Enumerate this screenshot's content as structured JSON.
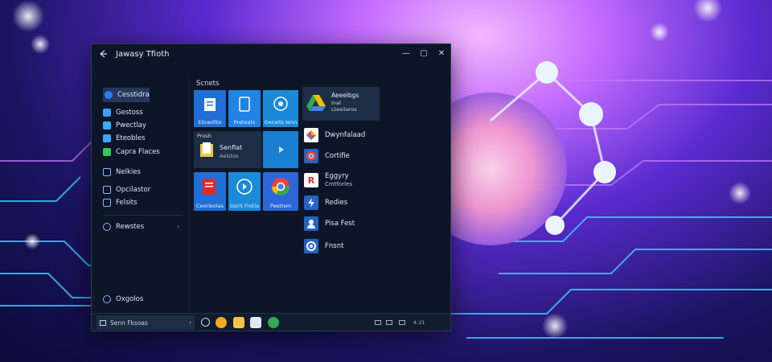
{
  "window": {
    "title": "Jawasy Tfioth",
    "controls": {
      "minimize": "—",
      "maximize": "▢",
      "close": "✕"
    }
  },
  "sidebar": {
    "items": [
      {
        "label": "Cesstidra",
        "icon": "compass-icon",
        "color": "#2f7bff"
      },
      {
        "label": "Gestoss",
        "icon": "shield-icon",
        "color": "#39a0ff"
      },
      {
        "label": "Pwectlay",
        "icon": "photo-icon",
        "color": "#36b0ff"
      },
      {
        "label": "Eteobles",
        "icon": "folder-icon",
        "color": "#3aa7ff"
      },
      {
        "label": "Capra Flaces",
        "icon": "sparkle-icon",
        "color": "#34c759"
      },
      {
        "label": "Nelkies",
        "icon": "chat-icon",
        "color": "#8fb3ff"
      },
      {
        "label": "Opcilastor",
        "icon": "document-icon",
        "color": "#8fb3ff"
      },
      {
        "label": "Felsits",
        "icon": "gear-icon",
        "color": "#8fb3ff"
      },
      {
        "label": "Rewstes",
        "icon": "user-icon",
        "color": "#8fb3ff"
      }
    ],
    "bottom": {
      "label": "Oxgolos",
      "icon": "refresh-icon"
    }
  },
  "main": {
    "section_label": "Scnets",
    "tiles": [
      {
        "label": "Etoaofite",
        "icon": "doc-icon",
        "color": "#1f6fd6"
      },
      {
        "label": "Pretoats",
        "icon": "tablet-icon",
        "color": "#1f84e6"
      },
      {
        "label": "Geceits Ienn",
        "icon": "globe-icon",
        "color": "#1a8ad9"
      },
      {
        "label": "Prosh",
        "sub": "Senflat",
        "sub2": "Aelstos",
        "icon": "folder-icon",
        "color": "#1d2d45"
      },
      {
        "label": "Ceorleolas",
        "icon": "pdf-icon",
        "color": "#1f6fd6"
      },
      {
        "label": "Gorit Frotia",
        "icon": "media-icon",
        "color": "#1a8ad9"
      },
      {
        "label": "Peettwn",
        "icon": "chrome-icon",
        "color": "#2c66d8"
      }
    ],
    "featured": {
      "line1": "Aeeelbgs",
      "line2": "Inal",
      "line3": "Ltesitaros",
      "icon": "drive-icon"
    },
    "list": [
      {
        "label": "Dwynfalaad",
        "icon": "photos-icon"
      },
      {
        "label": "Cortifie",
        "icon": "chrome-icon"
      },
      {
        "label": "Eggyry",
        "label2": "Cmtforles",
        "icon": "r-icon"
      },
      {
        "label": "Redies",
        "icon": "lightning-icon"
      },
      {
        "label": "Pisa Fest",
        "icon": "user-icon"
      },
      {
        "label": "Fnsnt",
        "icon": "edge-icon"
      }
    ]
  },
  "taskbar": {
    "search": "Senn Fksoas",
    "tray": "4:21"
  }
}
